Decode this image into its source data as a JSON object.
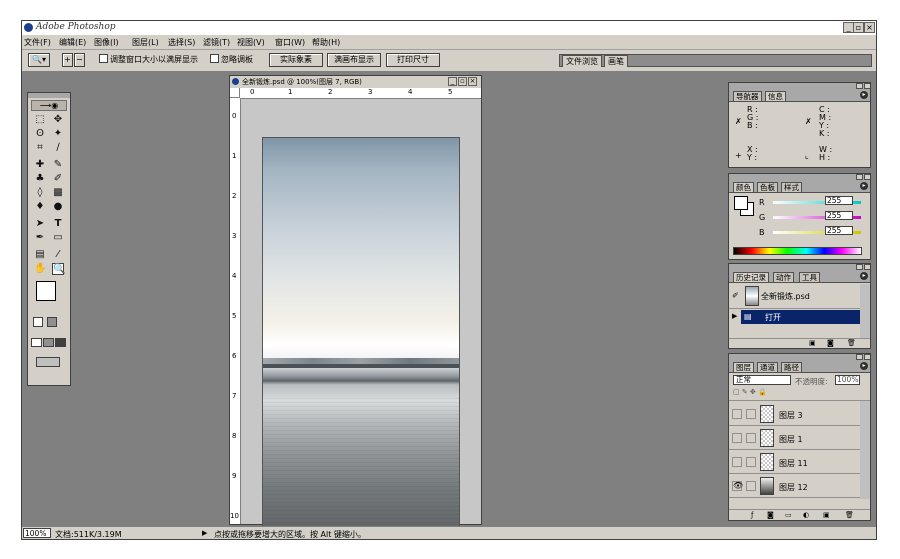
{
  "app": {
    "title": "Adobe Photoshop"
  },
  "window_buttons": {
    "minimize": "_",
    "restore": "▫",
    "close": "×"
  },
  "menu": [
    "文件(F)",
    "编辑(E)",
    "图像(I)",
    "图层(L)",
    "选择(S)",
    "滤镜(T)",
    "视图(V)",
    "窗口(W)",
    "帮助(H)"
  ],
  "options": {
    "resize_window_label": "调整窗口大小以满屏显示",
    "ignore_palettes_label": "忽略调板",
    "actual_pixels": "实际象素",
    "fit_on_screen": "满画布显示",
    "print_size": "打印尺寸",
    "palette_well_tabs": [
      "文件浏览",
      "画笔"
    ]
  },
  "document": {
    "title": "全新锻炼.psd @ 100%(图层 7, RGB)",
    "ruler_h": [
      "0",
      "1",
      "2",
      "3",
      "4",
      "5"
    ],
    "ruler_v": [
      "0",
      "1",
      "2",
      "3",
      "4",
      "5",
      "6",
      "7",
      "8",
      "9",
      "10"
    ]
  },
  "navigator_panel": {
    "tabs": [
      "导航器",
      "信息"
    ],
    "info": {
      "r": "R :",
      "g": "G :",
      "b": "B :",
      "c": "C :",
      "m": "M :",
      "y": "Y :",
      "k": "K :",
      "x": "X :",
      "ylab": "Y :",
      "w": "W :",
      "h": "H :"
    }
  },
  "color_panel": {
    "tabs": [
      "颜色",
      "色板",
      "样式"
    ],
    "channels": [
      {
        "label": "R",
        "value": "255",
        "color": "#00c8c8"
      },
      {
        "label": "G",
        "value": "255",
        "color": "#c800c8"
      },
      {
        "label": "B",
        "value": "255",
        "color": "#c8c800"
      }
    ]
  },
  "history_panel": {
    "tabs": [
      "历史记录",
      "动作",
      "工具"
    ],
    "snapshot": "全新锻炼.psd",
    "items": [
      "打开"
    ]
  },
  "layers_panel": {
    "tabs": [
      "图层",
      "通道",
      "路径"
    ],
    "blend_mode": "正常",
    "opacity_label": "不透明度:",
    "opacity": "100%",
    "layers": [
      "图层 3",
      "图层 1",
      "图层 11",
      "图层 12"
    ]
  },
  "status": {
    "zoom": "100%",
    "doc_size": "文档:511K/3.19M",
    "hint": "点按或拖移要增大的区域。按 Alt 键缩小。"
  }
}
